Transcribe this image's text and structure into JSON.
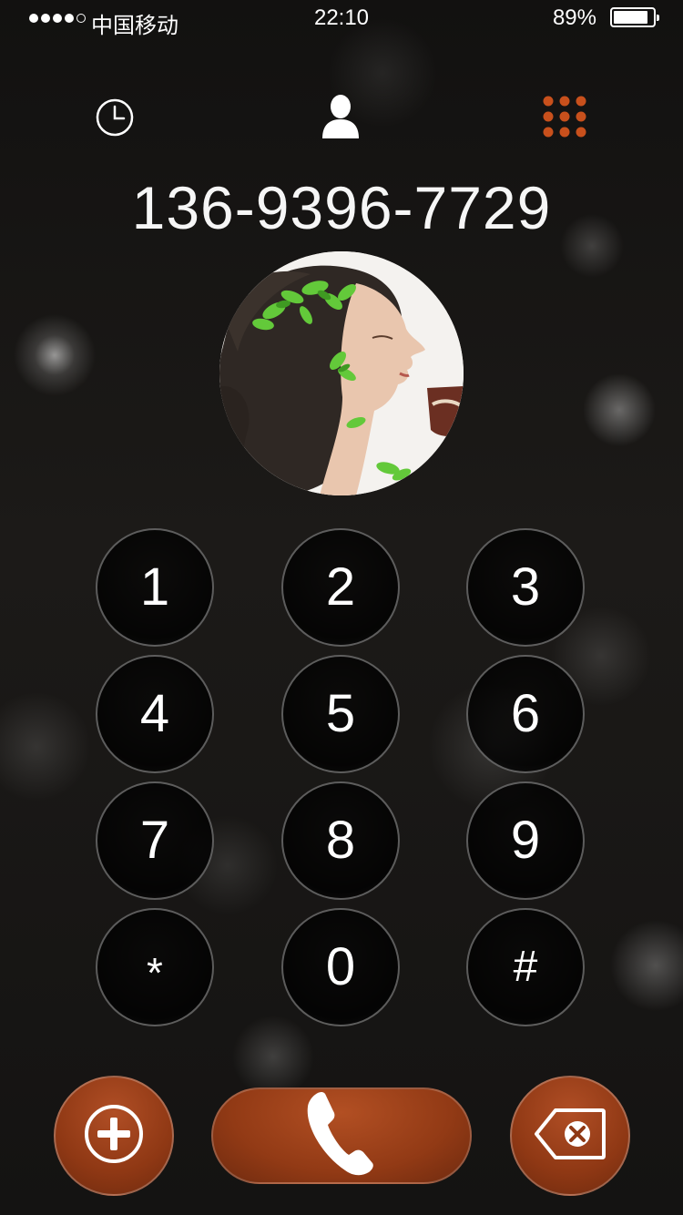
{
  "status_bar": {
    "carrier": "中国移动",
    "time": "22:10",
    "battery_percent": "89%",
    "battery_level": 0.89,
    "signal_bars_filled": 4,
    "signal_bars_total": 5
  },
  "nav": {
    "icons": [
      "clock-icon",
      "contact-person-icon",
      "dialpad-grid-icon"
    ],
    "active": "dialpad",
    "accent_color": "#c8501c"
  },
  "dialer": {
    "number": "136-9396-7729"
  },
  "keypad": {
    "keys": [
      "1",
      "2",
      "3",
      "4",
      "5",
      "6",
      "7",
      "8",
      "9",
      "*",
      "0",
      "#"
    ]
  },
  "actions": {
    "add_icon": "plus-circle-icon",
    "call_icon": "phone-handset-icon",
    "delete_icon": "backspace-icon",
    "button_color": "#8f3814"
  }
}
